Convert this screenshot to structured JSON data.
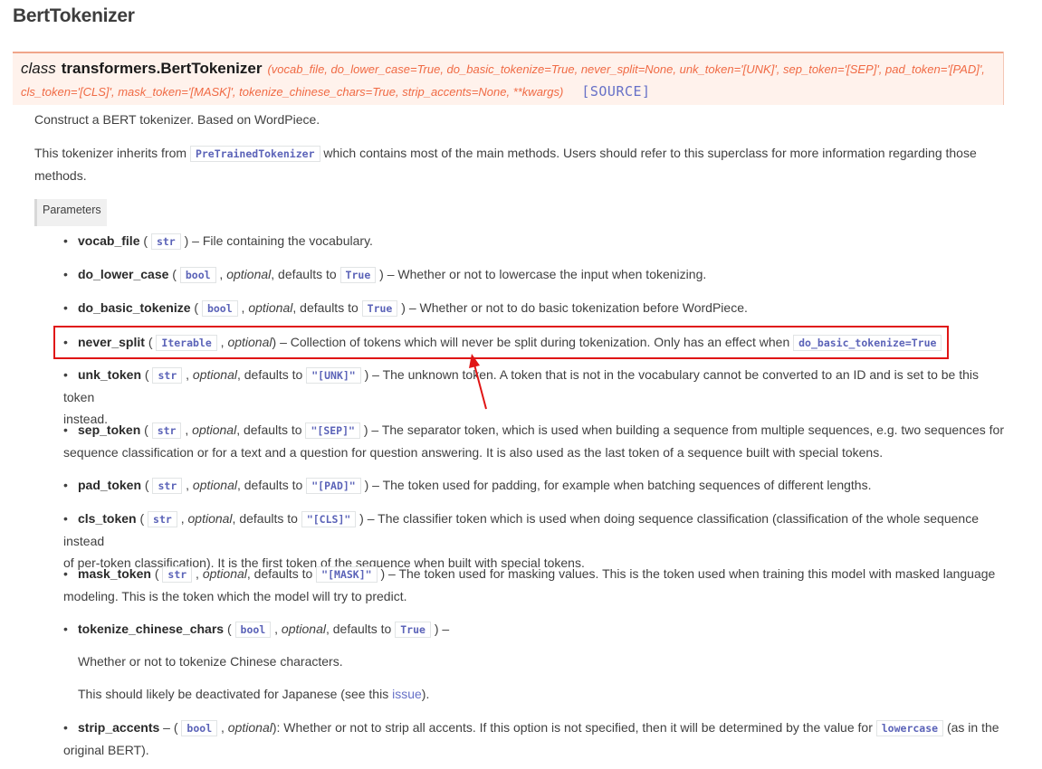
{
  "title": "BertTokenizer",
  "signature": {
    "keyword": "class",
    "name": "transformers.BertTokenizer",
    "params_line1": "(vocab_file, do_lower_case=True, do_basic_tokenize=True, never_split=None, unk_token='[UNK]', sep_token='[SEP]', pad_token='[PAD]',",
    "params_line2": "cls_token='[CLS]', mask_token='[MASK]', tokenize_chinese_chars=True, strip_accents=None, **kwargs)",
    "source_label": "[SOURCE]"
  },
  "description": "Construct a BERT tokenizer. Based on WordPiece.",
  "inherits": {
    "prefix": "This tokenizer inherits from",
    "class_ref": "PreTrainedTokenizer",
    "suffix_line1": "which contains most of the main methods. Users should refer to this superclass for more information regarding those",
    "suffix_line2": "methods."
  },
  "parameters_label": "Parameters",
  "params": {
    "vocab_file": {
      "name": "vocab_file",
      "type": "str",
      "desc": "– File containing the vocabulary."
    },
    "do_lower_case": {
      "name": "do_lower_case",
      "type": "bool",
      "optional": "optional",
      "defaults": ", defaults to",
      "default": "True",
      "desc": "– Whether or not to lowercase the input when tokenizing."
    },
    "do_basic_tokenize": {
      "name": "do_basic_tokenize",
      "type": "bool",
      "optional": "optional",
      "defaults": ", defaults to",
      "default": "True",
      "desc": "– Whether or not to do basic tokenization before WordPiece."
    },
    "never_split": {
      "name": "never_split",
      "type": "Iterable",
      "optional": "optional",
      "desc": "– Collection of tokens which will never be split during tokenization. Only has an effect when",
      "ref": "do_basic_tokenize=True"
    },
    "unk_token": {
      "name": "unk_token",
      "type": "str",
      "optional": "optional",
      "defaults": ", defaults to",
      "default": "\"[UNK]\"",
      "desc1": "– The unknown token. A token that is not in the vocabulary cannot be converted to an ID and is set to be this token",
      "desc2": "instead."
    },
    "sep_token": {
      "name": "sep_token",
      "type": "str",
      "optional": "optional",
      "defaults": ", defaults to",
      "default": "\"[SEP]\"",
      "desc1": "– The separator token, which is used when building a sequence from multiple sequences, e.g. two sequences for",
      "desc2": "sequence classification or for a text and a question for question answering. It is also used as the last token of a sequence built with special tokens."
    },
    "pad_token": {
      "name": "pad_token",
      "type": "str",
      "optional": "optional",
      "defaults": ", defaults to",
      "default": "\"[PAD]\"",
      "desc": "– The token used for padding, for example when batching sequences of different lengths."
    },
    "cls_token": {
      "name": "cls_token",
      "type": "str",
      "optional": "optional",
      "defaults": ", defaults to",
      "default": "\"[CLS]\"",
      "desc1": "– The classifier token which is used when doing sequence classification (classification of the whole sequence instead",
      "desc2": "of per-token classification). It is the first token of the sequence when built with special tokens."
    },
    "mask_token": {
      "name": "mask_token",
      "type": "str",
      "optional": "optional",
      "defaults": ", defaults to",
      "default": "\"[MASK]\"",
      "desc1": "– The token used for masking values. This is the token used when training this model with masked language",
      "desc2": "modeling. This is the token which the model will try to predict."
    },
    "tokenize_chinese_chars": {
      "name": "tokenize_chinese_chars",
      "type": "bool",
      "optional": "optional",
      "defaults": ", defaults to",
      "default": "True",
      "desc": "–",
      "sub1": "Whether or not to tokenize Chinese characters.",
      "sub2_prefix": "This should likely be deactivated for Japanese (see this",
      "sub2_link": "issue",
      "sub2_suffix": ")."
    },
    "strip_accents": {
      "name": "strip_accents",
      "dash": "–",
      "type": "bool",
      "optional": "optional",
      "desc1": ": Whether or not to strip all accents. If this option is not specified, then it will be determined by the value for",
      "ref": "lowercase",
      "desc1_suffix": "(as in the",
      "desc2": "original BERT)."
    }
  },
  "colors": {
    "highlight_box": "#e01515",
    "signature_bg": "#fff2ec",
    "signature_params": "#f06a44",
    "link": "#6670c7"
  }
}
